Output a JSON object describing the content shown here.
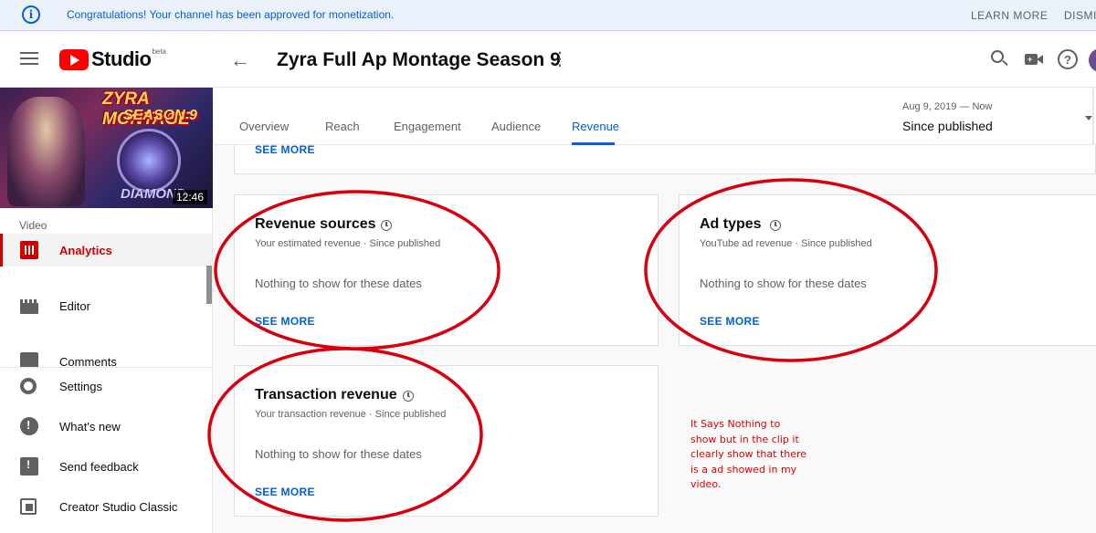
{
  "banner": {
    "message": "Congratulations! Your channel has been approved for monetization.",
    "learn_more": "LEARN MORE",
    "dismiss": "DISMI"
  },
  "header": {
    "logo_text": "Studio",
    "logo_badge": "beta",
    "back_icon": "←",
    "title": "Zyra Full Ap Montage Season 9",
    "more_icon": "⋮",
    "help_icon": "?"
  },
  "sidebar": {
    "thumbnail": {
      "title_line1": "ZYRA MONTAGE",
      "title_line2": "SEASON 9",
      "title_line3": "DIAMOND",
      "duration": "12:46"
    },
    "section_label": "Video",
    "items": [
      {
        "label": "Analytics",
        "icon": "analytics-icon"
      },
      {
        "label": "Editor",
        "icon": "editor-icon"
      },
      {
        "label": "Comments",
        "icon": "comments-icon"
      }
    ],
    "bottom_items": [
      {
        "label": "Settings",
        "icon": "settings-icon"
      },
      {
        "label": "What's new",
        "icon": "whats-new-icon"
      },
      {
        "label": "Send feedback",
        "icon": "feedback-icon"
      },
      {
        "label": "Creator Studio Classic",
        "icon": "classic-icon"
      }
    ]
  },
  "tabs": [
    {
      "label": "Overview"
    },
    {
      "label": "Reach"
    },
    {
      "label": "Engagement"
    },
    {
      "label": "Audience"
    },
    {
      "label": "Revenue",
      "active": true
    }
  ],
  "date_range": {
    "range": "Aug 9, 2019 — Now",
    "selected": "Since published"
  },
  "top_card": {
    "see_more": "SEE MORE"
  },
  "cards": {
    "revenue_sources": {
      "title": "Revenue sources",
      "subtitle": "Your estimated revenue · Since published",
      "empty": "Nothing to show for these dates",
      "see_more": "SEE MORE"
    },
    "ad_types": {
      "title": "Ad types",
      "subtitle": "YouTube ad revenue · Since published",
      "empty": "Nothing to show for these dates",
      "see_more": "SEE MORE"
    },
    "transaction_revenue": {
      "title": "Transaction revenue",
      "subtitle": "Your transaction revenue · Since published",
      "empty": "Nothing to show for these dates",
      "see_more": "SEE MORE"
    }
  },
  "annotation": {
    "text": "It Says Nothing to show but in the clip it clearly show that there is a ad showed in my video.",
    "color": "#e00000"
  },
  "colors": {
    "accent_blue": "#065fd4",
    "brand_red": "#ff0000",
    "active_red": "#cc0000"
  }
}
